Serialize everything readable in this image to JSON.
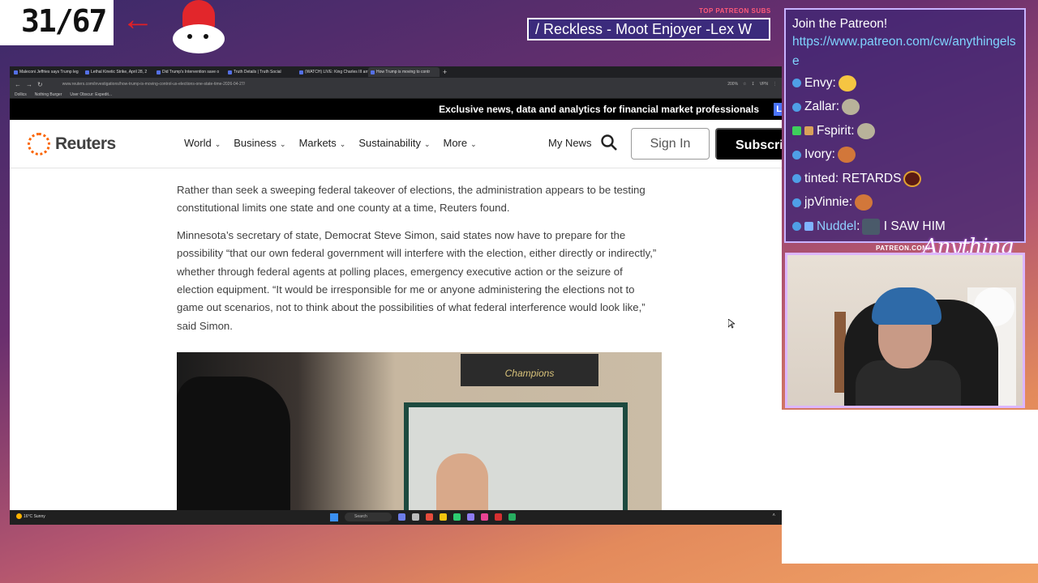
{
  "overlay": {
    "counter": "31/67",
    "patreon_subs_label": "TOP PATREON SUBS",
    "ticker": "/ Reckless - Moot Enjoyer -Lex W",
    "camera_brand": "PATREON.COM/",
    "camera_brand_script": "Anything Else"
  },
  "browser": {
    "tabs": [
      {
        "label": "Maleconi Jeffries says Trump leg"
      },
      {
        "label": "Lethal Kinetic Strike, April 28, 2"
      },
      {
        "label": "Did Trump's Intervention save o"
      },
      {
        "label": "Truth Details | Truth Social"
      },
      {
        "label": "(WATCH) LIVE: King Charles III arri"
      },
      {
        "label": "How Trump is moving to contr"
      }
    ],
    "url": "www.reuters.com/investigations/how-trump-is-moving-control-us-elections-one-state-time-2026-04-27/",
    "zoom": "200%",
    "vpn": "VPN",
    "bookmarks": [
      "Dollics",
      "Nothing Burger",
      "User Obscur: Expedit..."
    ]
  },
  "site": {
    "promo_text": "Exclusive news, data and analytics for financial market professionals",
    "promo_cta": "L",
    "logo": "Reuters",
    "menu": [
      "World",
      "Business",
      "Markets",
      "Sustainability",
      "More"
    ],
    "my_news": "My News",
    "sign_in": "Sign In",
    "subscribe": "Subscribe"
  },
  "article": {
    "paragraphs": [
      "Rather than seek a sweeping federal takeover of elections, the administration appears to be testing constitutional limits one state and one county at a time, Reuters found.",
      "Minnesota’s secretary of state, Democrat Steve Simon, said states now have to prepare for the possibility “that our own federal government will interfere with the election, either directly or indirectly,” whether through federal agents at polling places, emergency executive action or the seizure of election equipment. “It would be irresponsible for me or anyone administering the elections not to game out scenarios, not to think about the possibilities of what federal interference would look like,” said Simon."
    ],
    "photo_banner": "Champions"
  },
  "taskbar": {
    "temperature": "16°C",
    "condition": "Sunny",
    "search": "Search"
  },
  "chat": {
    "title": "Join the Patreon!",
    "link": "https://www.patreon.com/cw/anythingelse",
    "messages": [
      {
        "user": "Envy",
        "text": ""
      },
      {
        "user": "Zallar",
        "text": ""
      },
      {
        "user": "Fspirit",
        "text": ""
      },
      {
        "user": "Ivory",
        "text": ""
      },
      {
        "user": "tinted",
        "text": "RETARDS"
      },
      {
        "user": "jpVinnie",
        "text": ""
      },
      {
        "user": "Nuddel",
        "text": "I SAW HIM"
      }
    ],
    "colors": {
      "Envy": "#ffffff",
      "Zallar": "#ffffff",
      "Fspirit": "#ffffff",
      "Ivory": "#ffffff",
      "tinted": "#ffffff",
      "jpVinnie": "#ffffff",
      "Nuddel": "#8fd0ff"
    }
  },
  "colors": {
    "reuters_orange": "#fa6400",
    "chat_bg": "#402674",
    "ticker_bg": "#3b2b7c"
  }
}
